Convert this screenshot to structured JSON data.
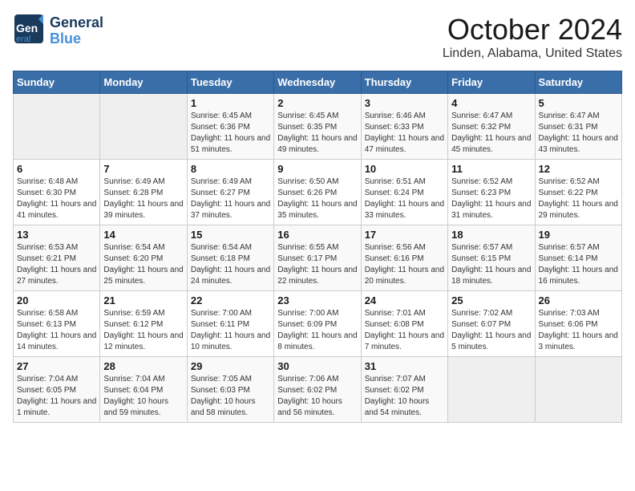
{
  "logo": {
    "general": "General",
    "blue": "Blue"
  },
  "title": "October 2024",
  "subtitle": "Linden, Alabama, United States",
  "days_of_week": [
    "Sunday",
    "Monday",
    "Tuesday",
    "Wednesday",
    "Thursday",
    "Friday",
    "Saturday"
  ],
  "weeks": [
    [
      {
        "num": "",
        "info": ""
      },
      {
        "num": "",
        "info": ""
      },
      {
        "num": "1",
        "info": "Sunrise: 6:45 AM\nSunset: 6:36 PM\nDaylight: 11 hours and 51 minutes."
      },
      {
        "num": "2",
        "info": "Sunrise: 6:45 AM\nSunset: 6:35 PM\nDaylight: 11 hours and 49 minutes."
      },
      {
        "num": "3",
        "info": "Sunrise: 6:46 AM\nSunset: 6:33 PM\nDaylight: 11 hours and 47 minutes."
      },
      {
        "num": "4",
        "info": "Sunrise: 6:47 AM\nSunset: 6:32 PM\nDaylight: 11 hours and 45 minutes."
      },
      {
        "num": "5",
        "info": "Sunrise: 6:47 AM\nSunset: 6:31 PM\nDaylight: 11 hours and 43 minutes."
      }
    ],
    [
      {
        "num": "6",
        "info": "Sunrise: 6:48 AM\nSunset: 6:30 PM\nDaylight: 11 hours and 41 minutes."
      },
      {
        "num": "7",
        "info": "Sunrise: 6:49 AM\nSunset: 6:28 PM\nDaylight: 11 hours and 39 minutes."
      },
      {
        "num": "8",
        "info": "Sunrise: 6:49 AM\nSunset: 6:27 PM\nDaylight: 11 hours and 37 minutes."
      },
      {
        "num": "9",
        "info": "Sunrise: 6:50 AM\nSunset: 6:26 PM\nDaylight: 11 hours and 35 minutes."
      },
      {
        "num": "10",
        "info": "Sunrise: 6:51 AM\nSunset: 6:24 PM\nDaylight: 11 hours and 33 minutes."
      },
      {
        "num": "11",
        "info": "Sunrise: 6:52 AM\nSunset: 6:23 PM\nDaylight: 11 hours and 31 minutes."
      },
      {
        "num": "12",
        "info": "Sunrise: 6:52 AM\nSunset: 6:22 PM\nDaylight: 11 hours and 29 minutes."
      }
    ],
    [
      {
        "num": "13",
        "info": "Sunrise: 6:53 AM\nSunset: 6:21 PM\nDaylight: 11 hours and 27 minutes."
      },
      {
        "num": "14",
        "info": "Sunrise: 6:54 AM\nSunset: 6:20 PM\nDaylight: 11 hours and 25 minutes."
      },
      {
        "num": "15",
        "info": "Sunrise: 6:54 AM\nSunset: 6:18 PM\nDaylight: 11 hours and 24 minutes."
      },
      {
        "num": "16",
        "info": "Sunrise: 6:55 AM\nSunset: 6:17 PM\nDaylight: 11 hours and 22 minutes."
      },
      {
        "num": "17",
        "info": "Sunrise: 6:56 AM\nSunset: 6:16 PM\nDaylight: 11 hours and 20 minutes."
      },
      {
        "num": "18",
        "info": "Sunrise: 6:57 AM\nSunset: 6:15 PM\nDaylight: 11 hours and 18 minutes."
      },
      {
        "num": "19",
        "info": "Sunrise: 6:57 AM\nSunset: 6:14 PM\nDaylight: 11 hours and 16 minutes."
      }
    ],
    [
      {
        "num": "20",
        "info": "Sunrise: 6:58 AM\nSunset: 6:13 PM\nDaylight: 11 hours and 14 minutes."
      },
      {
        "num": "21",
        "info": "Sunrise: 6:59 AM\nSunset: 6:12 PM\nDaylight: 11 hours and 12 minutes."
      },
      {
        "num": "22",
        "info": "Sunrise: 7:00 AM\nSunset: 6:11 PM\nDaylight: 11 hours and 10 minutes."
      },
      {
        "num": "23",
        "info": "Sunrise: 7:00 AM\nSunset: 6:09 PM\nDaylight: 11 hours and 8 minutes."
      },
      {
        "num": "24",
        "info": "Sunrise: 7:01 AM\nSunset: 6:08 PM\nDaylight: 11 hours and 7 minutes."
      },
      {
        "num": "25",
        "info": "Sunrise: 7:02 AM\nSunset: 6:07 PM\nDaylight: 11 hours and 5 minutes."
      },
      {
        "num": "26",
        "info": "Sunrise: 7:03 AM\nSunset: 6:06 PM\nDaylight: 11 hours and 3 minutes."
      }
    ],
    [
      {
        "num": "27",
        "info": "Sunrise: 7:04 AM\nSunset: 6:05 PM\nDaylight: 11 hours and 1 minute."
      },
      {
        "num": "28",
        "info": "Sunrise: 7:04 AM\nSunset: 6:04 PM\nDaylight: 10 hours and 59 minutes."
      },
      {
        "num": "29",
        "info": "Sunrise: 7:05 AM\nSunset: 6:03 PM\nDaylight: 10 hours and 58 minutes."
      },
      {
        "num": "30",
        "info": "Sunrise: 7:06 AM\nSunset: 6:02 PM\nDaylight: 10 hours and 56 minutes."
      },
      {
        "num": "31",
        "info": "Sunrise: 7:07 AM\nSunset: 6:02 PM\nDaylight: 10 hours and 54 minutes."
      },
      {
        "num": "",
        "info": ""
      },
      {
        "num": "",
        "info": ""
      }
    ]
  ]
}
